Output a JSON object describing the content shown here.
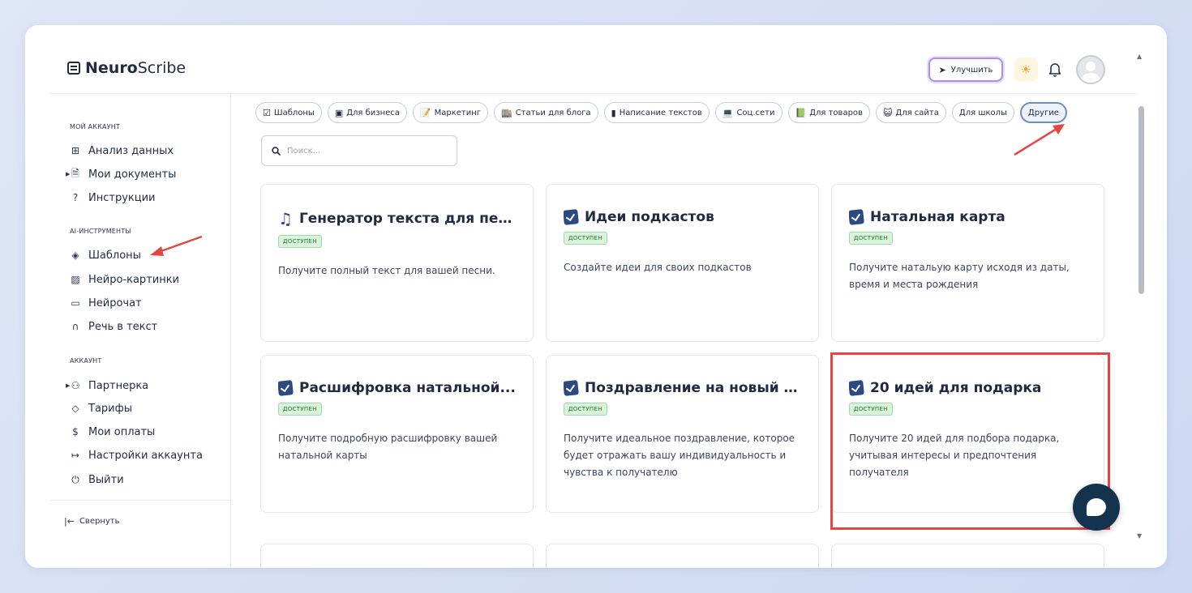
{
  "brand": {
    "bold": "Neuro",
    "regular": "Scribe"
  },
  "header": {
    "upgrade_label": "Улучшить"
  },
  "sidebar": {
    "section_account": "МОЙ АККАУНТ",
    "account_items": [
      {
        "label": "Анализ данных",
        "icon": "grid-icon"
      },
      {
        "label": "Мои документы",
        "icon": "document-icon"
      },
      {
        "label": "Инструкции",
        "icon": "help-circle-icon"
      }
    ],
    "section_ai": "AI-ИНСТРУМЕНТЫ",
    "ai_items": [
      {
        "label": "Шаблоны",
        "icon": "layers-icon"
      },
      {
        "label": "Нейро-картинки",
        "icon": "image-icon"
      },
      {
        "label": "Нейрочат",
        "icon": "chat-icon"
      },
      {
        "label": "Речь в текст",
        "icon": "headphones-icon"
      }
    ],
    "section_profile": "АККАУНТ",
    "profile_items": [
      {
        "label": "Партнерка",
        "icon": "users-icon"
      },
      {
        "label": "Тарифы",
        "icon": "tag-icon"
      },
      {
        "label": "Мои оплаты",
        "icon": "dollar-icon"
      },
      {
        "label": "Настройки аккаунта",
        "icon": "settings-exit-icon"
      },
      {
        "label": "Выйти",
        "icon": "power-icon"
      }
    ],
    "collapse_label": "Свернуть"
  },
  "chips": [
    {
      "label": "Шаблоны",
      "emoji": "☑"
    },
    {
      "label": "Для бизнеса",
      "emoji": "▣"
    },
    {
      "label": "Маркетинг",
      "emoji": "📝"
    },
    {
      "label": "Статьи для блога",
      "emoji": "🏬"
    },
    {
      "label": "Написание текстов",
      "emoji": "▮"
    },
    {
      "label": "Соц.сети",
      "emoji": "💻"
    },
    {
      "label": "Для товаров",
      "emoji": "📗"
    },
    {
      "label": "Для сайта",
      "emoji": "😺"
    },
    {
      "label": "Для школы",
      "emoji": ""
    },
    {
      "label": "Другие",
      "emoji": ""
    }
  ],
  "search": {
    "placeholder": "Поиск..."
  },
  "cards": [
    {
      "title": "Генератор текста для песни",
      "badge": "ДОСТУПЕН",
      "desc": "Получите полный текст для вашей песни.",
      "icon": "music-icon"
    },
    {
      "title": "Идеи подкастов",
      "badge": "ДОСТУПЕН",
      "desc": "Создайте идеи для своих подкастов",
      "icon": "check-icon"
    },
    {
      "title": "Натальная карта",
      "badge": "ДОСТУПЕН",
      "desc": "Получите натальую карту исходя из даты, время и места рождения",
      "icon": "check-icon"
    },
    {
      "title": "Расшифровка натальной...",
      "badge": "ДОСТУПЕН",
      "desc": "Получите подробную расшифровку вашей натальной карты",
      "icon": "check-icon"
    },
    {
      "title": "Поздравление на новый год",
      "badge": "ДОСТУПЕН",
      "desc": "Получите идеальное поздравление, которое будет отражать вашу индивидуальность и чувства к получателю",
      "icon": "check-icon"
    },
    {
      "title": "20 идей для подарка",
      "badge": "ДОСТУПЕН",
      "desc": "Получите 20 идей для подбора подарка, учитывая интересы и предпочтения получателя",
      "icon": "check-icon"
    }
  ],
  "colors": {
    "accent": "#2b4a82",
    "highlight": "#e64545",
    "badge_bg": "#d6f5d9"
  }
}
